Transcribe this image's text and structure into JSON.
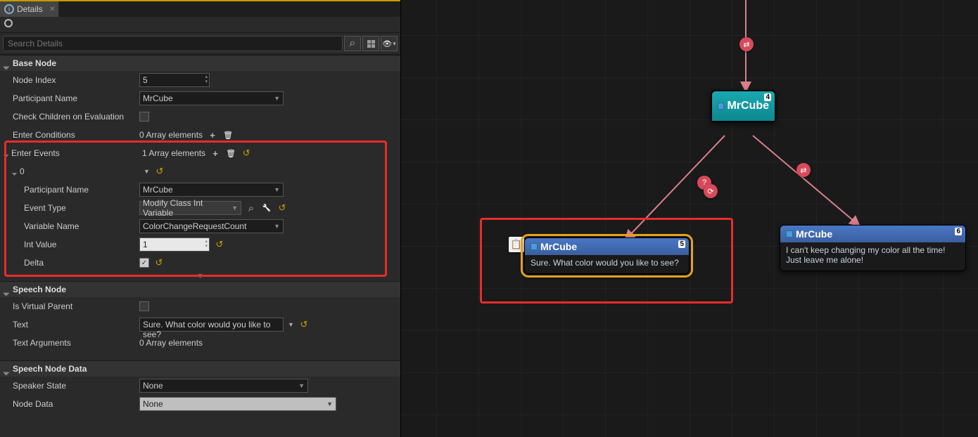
{
  "tab": {
    "title": "Details"
  },
  "search": {
    "placeholder": "Search Details"
  },
  "sections": {
    "base": {
      "title": "Base Node",
      "node_index": {
        "label": "Node Index",
        "value": "5"
      },
      "participant_name": {
        "label": "Participant Name",
        "value": "MrCube"
      },
      "check_children": {
        "label": "Check Children on Evaluation",
        "checked": false
      },
      "enter_conditions": {
        "label": "Enter Conditions",
        "count": "0 Array elements"
      },
      "enter_events": {
        "label": "Enter Events",
        "count": "1 Array elements",
        "item0": {
          "label": "0",
          "participant_name": {
            "label": "Participant Name",
            "value": "MrCube"
          },
          "event_type": {
            "label": "Event Type",
            "value": "Modify Class Int Variable"
          },
          "variable_name": {
            "label": "Variable Name",
            "value": "ColorChangeRequestCount"
          },
          "int_value": {
            "label": "Int Value",
            "value": "1"
          },
          "delta": {
            "label": "Delta",
            "checked": true
          }
        }
      }
    },
    "speech": {
      "title": "Speech Node",
      "is_virtual": {
        "label": "Is Virtual Parent",
        "checked": false
      },
      "text": {
        "label": "Text",
        "value": "Sure. What color would you like to see?"
      },
      "text_args": {
        "label": "Text Arguments",
        "count": "0 Array elements"
      }
    },
    "speech_data": {
      "title": "Speech Node Data",
      "speaker_state": {
        "label": "Speaker State",
        "value": "None"
      },
      "node_data": {
        "label": "Node Data",
        "value": "None"
      }
    }
  },
  "graph": {
    "node4": {
      "title": "MrCube",
      "index": "4"
    },
    "node5": {
      "title": "MrCube",
      "index": "5",
      "text": "Sure. What color would you like to see?"
    },
    "node6": {
      "title": "MrCube",
      "index": "6",
      "line1": "I can't keep changing my color all the time!",
      "line2": "Just leave me alone!"
    }
  }
}
